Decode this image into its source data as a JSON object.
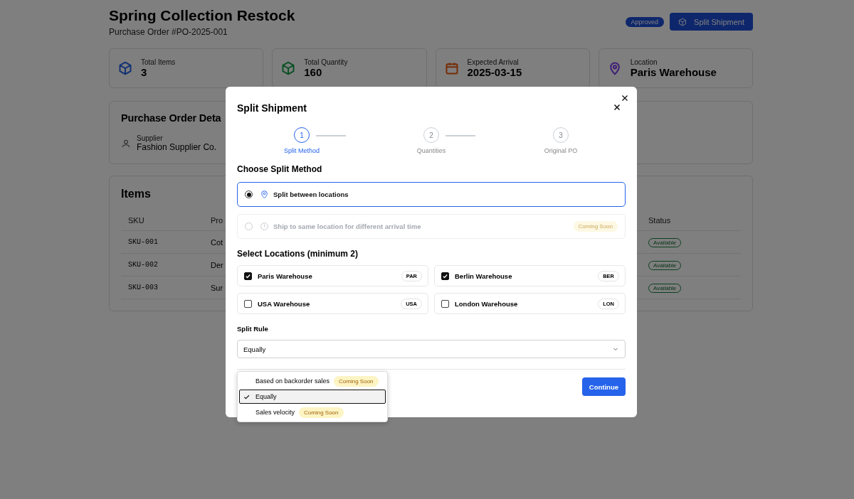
{
  "header": {
    "title": "Spring Collection Restock",
    "subtitle": "Purchase Order #PO-2025-001",
    "status_badge": "Approved",
    "action_button": "Split Shipment"
  },
  "stats": [
    {
      "kind": "box",
      "color": "#123175",
      "label": "Total Items",
      "value": "3"
    },
    {
      "kind": "box",
      "color": "#0b5125",
      "label": "Total Quantity",
      "value": "160"
    },
    {
      "kind": "calendar",
      "color": "#752c06",
      "label": "Expected Arrival",
      "value": "2025-03-15"
    },
    {
      "kind": "pin",
      "color": "#3e1d76",
      "label": "Location",
      "value": "Paris Warehouse"
    }
  ],
  "details": {
    "title": "Purchase Order Deta",
    "fields": [
      {
        "label": "Supplier",
        "value": "Fashion Supplier Co."
      }
    ]
  },
  "items": {
    "title": "Items",
    "columns": [
      "SKU",
      "Pro",
      "Status"
    ],
    "rows": [
      {
        "sku": "SKU-001",
        "column_2": "Cot",
        "status": "Available"
      },
      {
        "sku": "SKU-002",
        "column_2": "Der",
        "status": "Available"
      },
      {
        "sku": "SKU-003",
        "column_2": "Sur",
        "status": "Available"
      }
    ]
  },
  "modal": {
    "title": "Split Shipment",
    "steps": [
      {
        "number": "1",
        "label": "Split Method",
        "selected": true
      },
      {
        "number": "2",
        "label": "Quantities",
        "selected": false
      },
      {
        "number": "3",
        "label": "Original PO",
        "selected": false
      }
    ],
    "method_heading": "Choose Split Method",
    "methods": [
      {
        "kind": "pin",
        "label": "Split between locations",
        "selected": true,
        "disabled": false
      },
      {
        "kind": "clock",
        "label": "Ship to same location for different arrival time",
        "selected": false,
        "disabled": true,
        "badge": "Coming Soon"
      }
    ],
    "locations_heading": "Select Locations (minimum 2)",
    "locations": [
      {
        "name": "Paris Warehouse",
        "code": "PAR",
        "checked": true
      },
      {
        "name": "Berlin Warehouse",
        "code": "BER",
        "checked": true
      },
      {
        "name": "USA Warehouse",
        "code": "USA",
        "checked": false
      },
      {
        "name": "London Warehouse",
        "code": "LON",
        "checked": false
      }
    ],
    "split_rule": {
      "label": "Split Rule",
      "value": "Equally",
      "expanded": true,
      "options": [
        {
          "label": "Based on backorder sales",
          "selected": false,
          "badge": "Coming Soon"
        },
        {
          "label": "Equally",
          "selected": true
        },
        {
          "label": "Sales velocity",
          "selected": false,
          "badge": "Coming Soon"
        }
      ]
    },
    "continue_button": "Continue"
  }
}
